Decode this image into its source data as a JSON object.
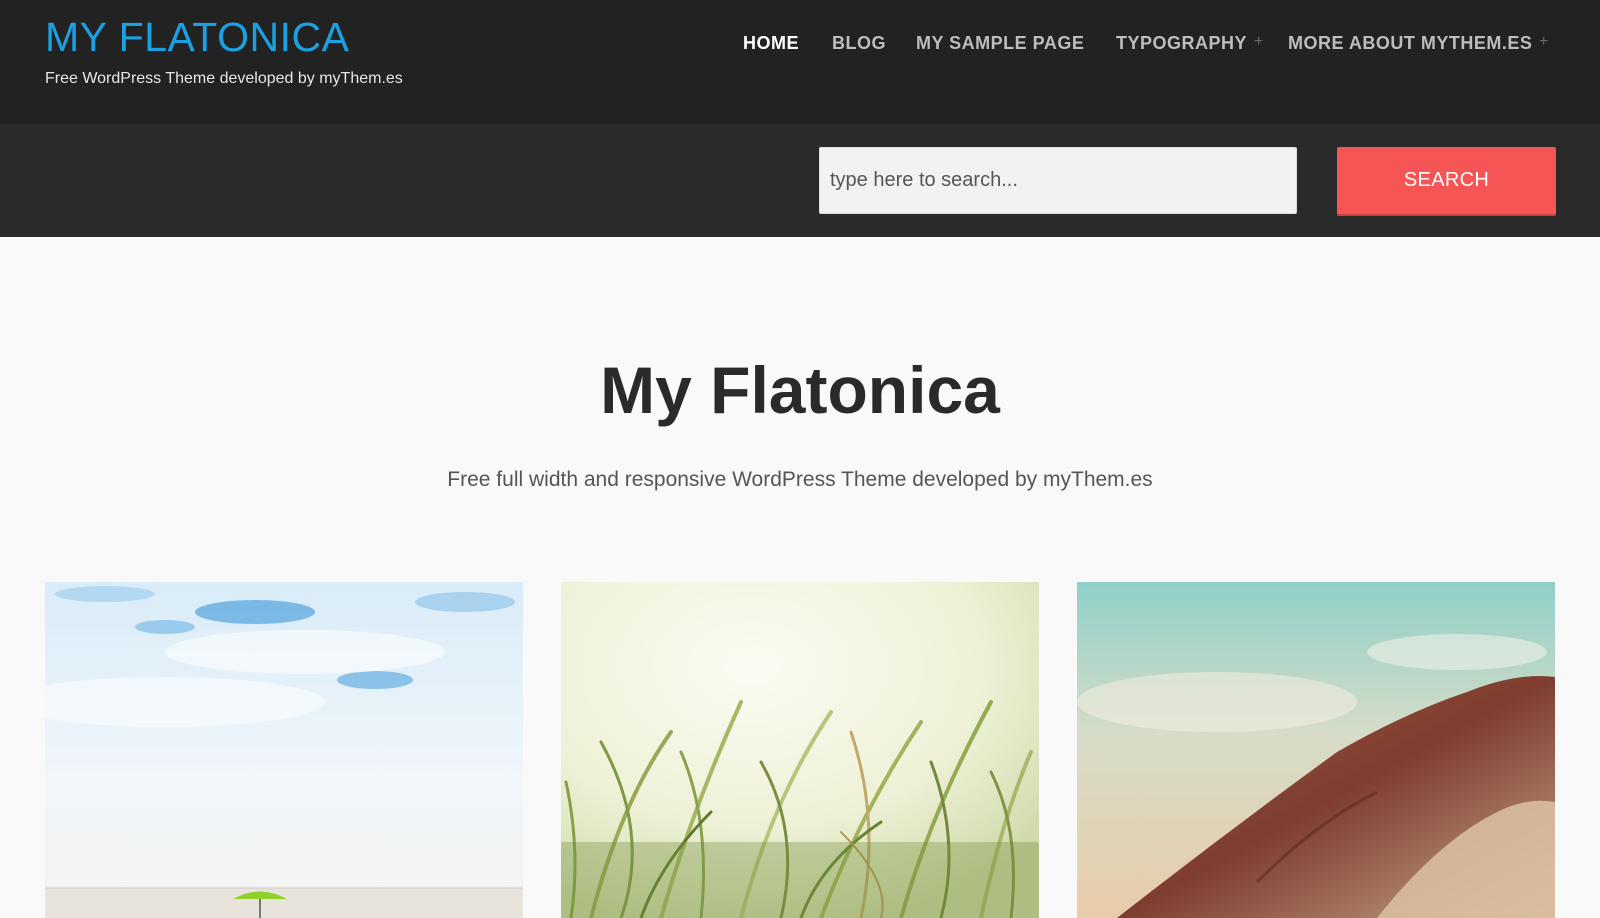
{
  "header": {
    "site_title": "MY FLATONICA",
    "site_description": "Free WordPress Theme developed by myThem.es"
  },
  "nav": {
    "items": [
      {
        "label": "HOME",
        "active": true
      },
      {
        "label": "BLOG"
      },
      {
        "label": "MY SAMPLE PAGE"
      },
      {
        "label": "TYPOGRAPHY",
        "has_submenu": true
      },
      {
        "label": "MORE ABOUT MYTHEM.ES",
        "has_submenu": true
      }
    ],
    "submenu_icon": "+"
  },
  "search": {
    "placeholder": "type here to search...",
    "value": "",
    "button_label": "SEARCH"
  },
  "hero": {
    "title": "My Flatonica",
    "subtitle": "Free full width and responsive WordPress Theme developed by myThem.es"
  },
  "posts": [
    {
      "thumbnail": "beach-sky-umbrella-photo"
    },
    {
      "thumbnail": "tall-grass-photo"
    },
    {
      "thumbnail": "red-rock-cliff-photo"
    }
  ],
  "colors": {
    "header_bg": "#222222",
    "search_bar_bg": "#2a2a2a",
    "title_blue": "#1ba1e2",
    "search_button": "#f65556",
    "page_bg": "#f9f9f9"
  }
}
